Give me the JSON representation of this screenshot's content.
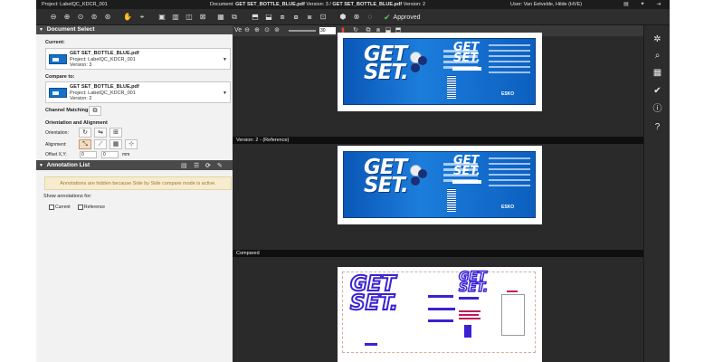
{
  "topbar": {
    "project": "Project: LabelQC_KDCR_001",
    "document_prefix": "Document: ",
    "document_current": "GET SET_BOTTLE_BLUE.pdf",
    "document_mid": " Version: 3 / ",
    "document_reference": "GET SET_BOTTLE_BLUE.pdf",
    "document_suffix": " Version: 2",
    "user": "User: Van Eetvelde, Hilde (HVE)"
  },
  "toolbar": {
    "approved_label": "Approved"
  },
  "document_select": {
    "title": "Document Select",
    "current_label": "Current:",
    "current": {
      "filename": "GET SET_BOTTLE_BLUE.pdf",
      "project": "Project: LabelQC_KDCR_001",
      "version": "Version: 3"
    },
    "compare_label": "Compare to:",
    "compare": {
      "filename": "GET SET_BOTTLE_BLUE.pdf",
      "project": "Project: LabelQC_KDCR_001",
      "version": "Version: 2"
    },
    "channel_matching_label": "Channel Matching:",
    "orientation_alignment_label": "Orientation and Alignment",
    "orientation_label": "Orientation:",
    "alignment_label": "Alignment:",
    "offset_label": "Offset X,Y:",
    "offset_x": "0",
    "offset_y": "0",
    "offset_unit": "mm"
  },
  "annotation_list": {
    "title": "Annotation List",
    "notice": "Annotations are hidden because Side by Side compare mode is active.",
    "show_for": "Show annotations for:",
    "current_label": "Current",
    "reference_label": "Reference"
  },
  "viewer": {
    "zoom_value": "30",
    "section_current": "Ve",
    "section_reference": "Version: 2 - (Reference)",
    "section_compared": "Compared",
    "label_brand": "GET SET."
  }
}
